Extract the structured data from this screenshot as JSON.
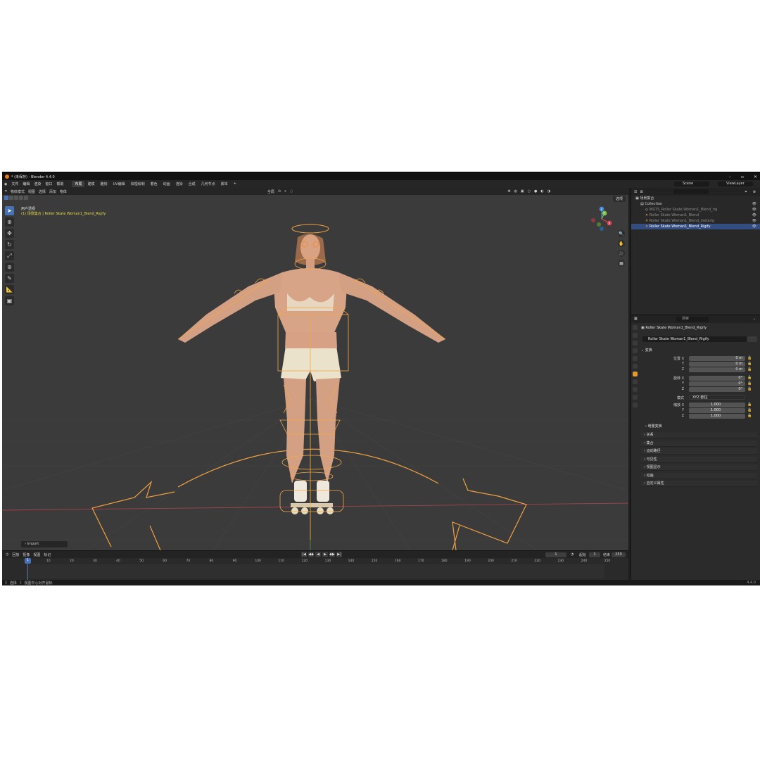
{
  "window": {
    "title": "* (未保存) - Blender 4.4.0"
  },
  "menu": [
    "文件",
    "编辑",
    "渲染",
    "窗口",
    "帮助"
  ],
  "workspaces": [
    {
      "label": "布局",
      "active": true
    },
    {
      "label": "建模",
      "active": false
    },
    {
      "label": "雕刻",
      "active": false
    },
    {
      "label": "UV编辑",
      "active": false
    },
    {
      "label": "纹理绘制",
      "active": false
    },
    {
      "label": "着色",
      "active": false
    },
    {
      "label": "动画",
      "active": false
    },
    {
      "label": "渲染",
      "active": false
    },
    {
      "label": "合成",
      "active": false
    },
    {
      "label": "几何节点",
      "active": false
    },
    {
      "label": "脚本",
      "active": false
    },
    {
      "label": "+",
      "active": false
    }
  ],
  "top_right": {
    "scene": "Scene",
    "view_layer": "ViewLayer"
  },
  "viewport": {
    "mode": "物体模式",
    "menus": [
      "视图",
      "选择",
      "添加",
      "物体"
    ],
    "transform_orientation": "全局",
    "options_label": "选项",
    "view_name": "用户透视",
    "active_info": "(1) 场景集合 | Roller Skate Woman1_Blend_Rigify",
    "last_op": "Import",
    "gizmo_axes": {
      "x": "X",
      "y": "Y",
      "z": "Z"
    },
    "colors": {
      "x_axis": "#d9414f",
      "y_axis": "#7bc24c",
      "z_axis": "#3c87d8",
      "selection": "#f5a040",
      "background": "#3b3b3b"
    }
  },
  "timeline": {
    "menus": [
      "回放",
      "抠像",
      "视图",
      "标记"
    ],
    "current_frame": "1",
    "start_label": "起始",
    "start": "1",
    "end_label": "结束",
    "end": "250",
    "playhead": "1",
    "ruler": [
      "10",
      "20",
      "30",
      "40",
      "50",
      "60",
      "70",
      "80",
      "90",
      "100",
      "110",
      "120",
      "130",
      "140",
      "150",
      "160",
      "170",
      "180",
      "190",
      "200",
      "210",
      "220",
      "230",
      "240",
      "250"
    ]
  },
  "outliner": {
    "search_placeholder": "",
    "rows": [
      {
        "label": "场景集合",
        "indent": 0,
        "selected": false,
        "dim": false
      },
      {
        "label": "Collection",
        "indent": 1,
        "selected": false,
        "dim": false
      },
      {
        "label": "WGTS_Roller Skate Woman1_Blend_rig",
        "indent": 2,
        "selected": false,
        "dim": true
      },
      {
        "label": "Roller Skate Woman1_Blend",
        "indent": 2,
        "selected": false,
        "dim": true
      },
      {
        "label": "Roller Skate Woman1_Blend_metarig",
        "indent": 2,
        "selected": false,
        "dim": true
      },
      {
        "label": "Roller Skate Woman1_Blend_Rigify",
        "indent": 2,
        "selected": true,
        "dim": false
      }
    ]
  },
  "properties": {
    "search_placeholder": "搜索",
    "object_name": "Roller Skate Woman1_Blend_Rigify",
    "object_field": "Roller Skate Woman1_Blend_Rigify",
    "transform_title": "变换",
    "location_label": "位置 X",
    "rotation_label": "旋转 X",
    "mode_label": "模式",
    "scale_label": "缩放 X",
    "y_label": "Y",
    "z_label": "Z",
    "location": [
      "0 m",
      "0 m",
      "0 m"
    ],
    "rotation": [
      "0°",
      "0°",
      "0°"
    ],
    "rotation_mode": "XYZ 欧拉",
    "scale": [
      "1.000",
      "1.000",
      "1.000"
    ],
    "delta_transform": "增量变换",
    "sections": [
      "关系",
      "集合",
      "运动路径",
      "可见性",
      "视图显示",
      "动画",
      "自定义属性"
    ]
  },
  "statusbar": {
    "select": "选择",
    "center": "视图中心对齐鼠标",
    "version": "4.4.0"
  }
}
